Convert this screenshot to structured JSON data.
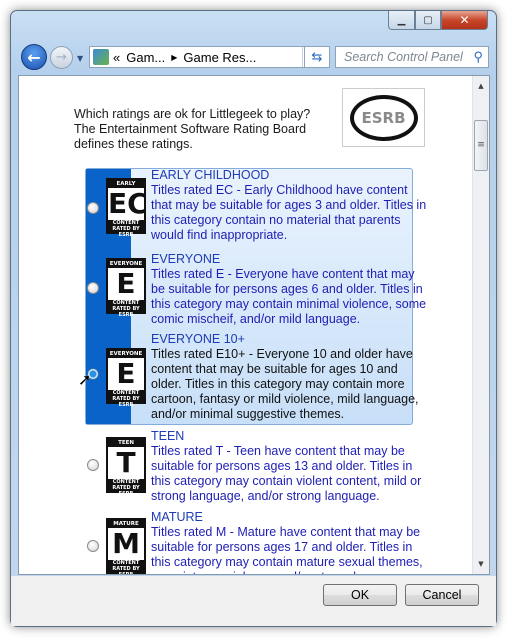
{
  "window": {
    "controls": {
      "minimize": "minimize-icon",
      "maximize": "maximize-icon",
      "close": "close-icon"
    }
  },
  "nav": {
    "breadcrumb_prefix": "«",
    "breadcrumbs": [
      "Gam...",
      "Game Res..."
    ],
    "search_placeholder": "Search Control Panel"
  },
  "main": {
    "intro": "Which ratings are ok for Littlegeek to play? The Entertainment Software Rating Board defines these ratings.",
    "logo": "ESRB",
    "ratings": [
      {
        "badge": "EC",
        "badge_top": "EARLY CHILDHOOD",
        "title": "EARLY CHILDHOOD",
        "desc": "Titles rated EC - Early Childhood have content that may be suitable for ages 3 and older.  Titles in this category contain no material that parents would find inappropriate.",
        "selected": false
      },
      {
        "badge": "E",
        "badge_top": "EVERYONE",
        "title": "EVERYONE",
        "desc": "Titles rated E - Everyone have content that may be suitable for persons ages 6 and older.  Titles in this category may contain minimal violence, some comic mischeif, and/or mild language.",
        "selected": false
      },
      {
        "badge": "E",
        "badge_top": "EVERYONE 10+",
        "title": "EVERYONE 10+",
        "desc": "Titles rated E10+ - Everyone 10 and older have content that may be suitable for ages 10 and older.  Titles in this category may contain more cartoon, fantasy or mild violence, mild language, and/or minimal suggestive themes.",
        "selected": true
      },
      {
        "badge": "T",
        "badge_top": "TEEN",
        "title": "TEEN",
        "desc": "Titles rated T - Teen have content that may be suitable for persons ages 13 and older.  Titles in this category may contain violent content, mild or strong language, and/or strong language.",
        "selected": false
      },
      {
        "badge": "M",
        "badge_top": "MATURE 17+",
        "title": "MATURE",
        "desc": "Titles rated M - Mature have content that may be suitable for persons ages 17 and older.  Titles in this category may contain mature sexual themes, more intense violence and/or strong language.",
        "selected": false
      }
    ],
    "badge_footer": "CONTENT RATED BY ESRB"
  },
  "buttons": {
    "ok": "OK",
    "cancel": "Cancel"
  },
  "colors": {
    "accent": "#0a63c9",
    "rating_text": "#1e1eb4"
  }
}
